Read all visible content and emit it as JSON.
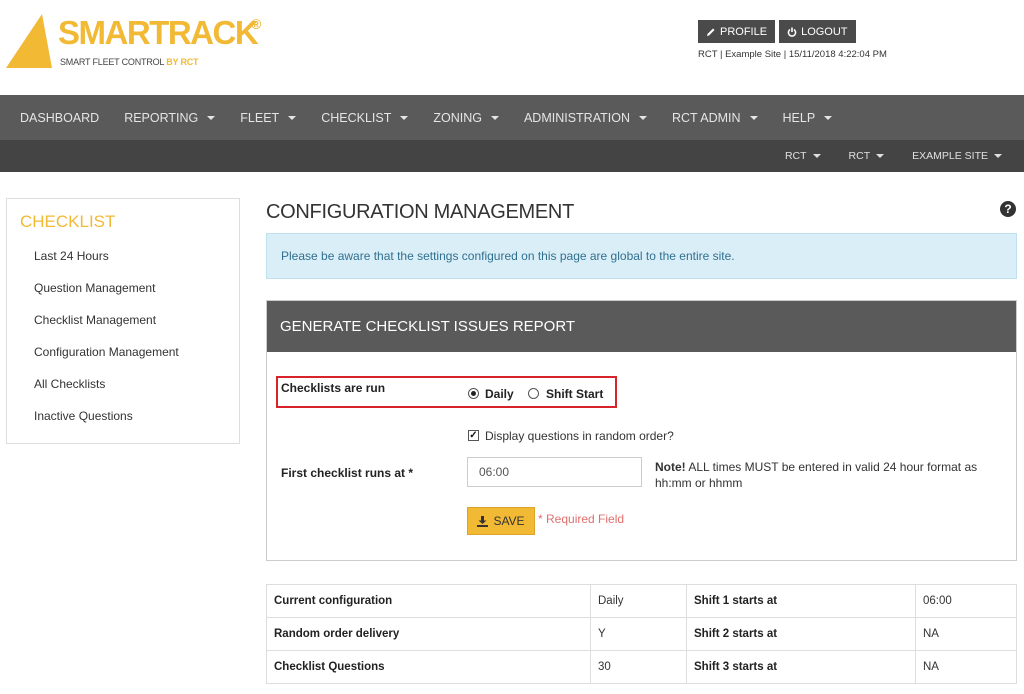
{
  "brand": {
    "name": "SMARTRACK",
    "registered": "®",
    "tagline": "SMART FLEET CONTROL",
    "tagline_by": "BY RCT",
    "color": "#f2b935"
  },
  "header": {
    "profile_label": "PROFILE",
    "logout_label": "LOGOUT",
    "info": "RCT | Example Site | 15/11/2018 4:22:04 PM"
  },
  "nav": {
    "primary": [
      {
        "label": "DASHBOARD",
        "dropdown": false
      },
      {
        "label": "REPORTING",
        "dropdown": true
      },
      {
        "label": "FLEET",
        "dropdown": true
      },
      {
        "label": "CHECKLIST",
        "dropdown": true
      },
      {
        "label": "ZONING",
        "dropdown": true
      },
      {
        "label": "ADMINISTRATION",
        "dropdown": true
      },
      {
        "label": "RCT ADMIN",
        "dropdown": true
      },
      {
        "label": "HELP",
        "dropdown": true
      }
    ],
    "secondary": [
      {
        "label": "RCT"
      },
      {
        "label": "RCT"
      },
      {
        "label": "EXAMPLE SITE"
      }
    ]
  },
  "sidebar": {
    "title": "CHECKLIST",
    "items": [
      {
        "label": "Last 24 Hours"
      },
      {
        "label": "Question Management"
      },
      {
        "label": "Checklist Management"
      },
      {
        "label": "Configuration Management"
      },
      {
        "label": "All Checklists"
      },
      {
        "label": "Inactive Questions"
      }
    ]
  },
  "main": {
    "title": "CONFIGURATION MANAGEMENT",
    "alert": "Please be aware that the settings configured on this page are global to the entire site.",
    "panel": {
      "title": "GENERATE CHECKLIST ISSUES REPORT",
      "run_label": "Checklists are run",
      "option_daily": "Daily",
      "option_shift": "Shift Start",
      "selected": "Daily",
      "random_label": "Display questions in random order?",
      "random_checked": true,
      "first_run_label": "First checklist runs at *",
      "first_run_value": "06:00",
      "note_bold": "Note!",
      "note_text": " ALL times MUST be entered in valid 24 hour format as hh:mm or hhmm",
      "save_label": "SAVE",
      "required_text": "* Required Field"
    },
    "summary": [
      {
        "k1": "Current configuration",
        "v1": "Daily",
        "k2": "Shift 1 starts at",
        "v2": "06:00"
      },
      {
        "k1": "Random order delivery",
        "v1": "Y",
        "k2": "Shift 2 starts at",
        "v2": "NA"
      },
      {
        "k1": "Checklist Questions",
        "v1": "30",
        "k2": "Shift 3 starts at",
        "v2": "NA"
      }
    ]
  }
}
